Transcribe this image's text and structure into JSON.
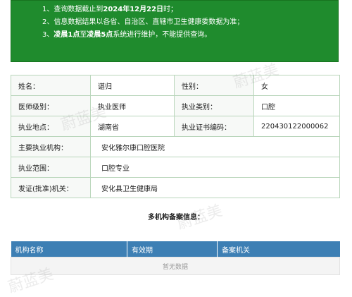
{
  "notice": {
    "line1_prefix": "1、查询数据截止到",
    "line1_date": "2024年12月22日",
    "line1_suffix": "时；",
    "line2": "2、信息数据结果以各省、自治区、直辖市卫生健康委数据为准；",
    "line3_prefix": "3、",
    "line3_hl1": "凌晨1点",
    "line3_mid": "至",
    "line3_hl2": "凌晨5点",
    "line3_suffix": "系统进行维护，不能提供查询。"
  },
  "info": {
    "name_label": "姓名：",
    "name_value": "谌归",
    "gender_label": "性别：",
    "gender_value": "女",
    "level_label": "医师级别：",
    "level_value": "执业医师",
    "category_label": "执业类别：",
    "category_value": "口腔",
    "location_label": "执业地点：",
    "location_value": "湖南省",
    "cert_label": "执业证书编码：",
    "cert_value": "220430122000062",
    "institution_label": "主要执业机构：",
    "institution_value": "安化雅尔康口腔医院",
    "scope_label": "执业范围：",
    "scope_value": "口腔专业",
    "issuer_label": "发证(批准)机关：",
    "issuer_value": "安化县卫生健康局"
  },
  "multi": {
    "title": "多机构备案信息：",
    "columns": [
      "机构名称",
      "有效期",
      "备案机关"
    ],
    "empty_text": "暂无数据"
  },
  "watermark": {
    "text": "蔚蓝美"
  }
}
